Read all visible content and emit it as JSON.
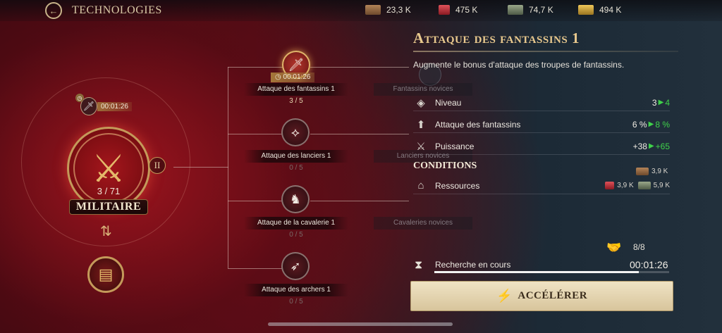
{
  "header": {
    "title": "TECHNOLOGIES",
    "resources": [
      {
        "icon": "wood-icon",
        "value": "23,3 K",
        "color": "#a0704a"
      },
      {
        "icon": "meat-icon",
        "value": "475 K",
        "color": "#c8323a"
      },
      {
        "icon": "stone-icon",
        "value": "74,7 K",
        "color": "#7a8a6a"
      },
      {
        "icon": "gold-icon",
        "value": "494 K",
        "color": "#d4a83a"
      }
    ]
  },
  "category": {
    "progress": "3 / 71",
    "name": "MILITAIRE",
    "tier": "II",
    "timer": "00:01:26"
  },
  "tree": {
    "nodes": [
      {
        "label": "Attaque des fantassins 1",
        "level": "3 / 5",
        "timer": "00:01:26",
        "icon": "sword-icon",
        "glyph": "🗡"
      },
      {
        "label": "Attaque des lanciers 1",
        "level": "0 / 5",
        "icon": "spear-icon",
        "glyph": "⟡"
      },
      {
        "label": "Attaque de la cavalerie 1",
        "level": "0 / 5",
        "icon": "horse-icon",
        "glyph": "♞"
      },
      {
        "label": "Attaque des archers 1",
        "level": "0 / 5",
        "icon": "crossbow-icon",
        "glyph": "➶"
      }
    ],
    "faded": [
      "Fantassins novices",
      "Lanciers novices",
      "Cavaleries novices"
    ]
  },
  "panel": {
    "title": "Attaque des fantassins 1",
    "description": "Augmente le bonus d'attaque des troupes de fantassins.",
    "stats": [
      {
        "label": "Niveau",
        "icon": "level-icon",
        "glyph": "◈",
        "current": "3",
        "next": "4"
      },
      {
        "label": "Attaque des fantassins",
        "icon": "attack-up-icon",
        "glyph": "⬆",
        "current": "6 %",
        "next": "8 %"
      },
      {
        "label": "Puissance",
        "icon": "power-icon",
        "glyph": "⚔",
        "current": "+38",
        "next": "+65"
      }
    ],
    "conditions_title": "CONDITIONS",
    "conditions": {
      "label": "Ressources",
      "wood": "3,9 K",
      "meat": "3,9 K",
      "stone": "5,9 K"
    },
    "queue": "8/8",
    "research": {
      "label": "Recherche en cours",
      "timer": "00:01:26",
      "progress": 0.87
    },
    "accelerate_label": "ACCÉLÉRER"
  }
}
